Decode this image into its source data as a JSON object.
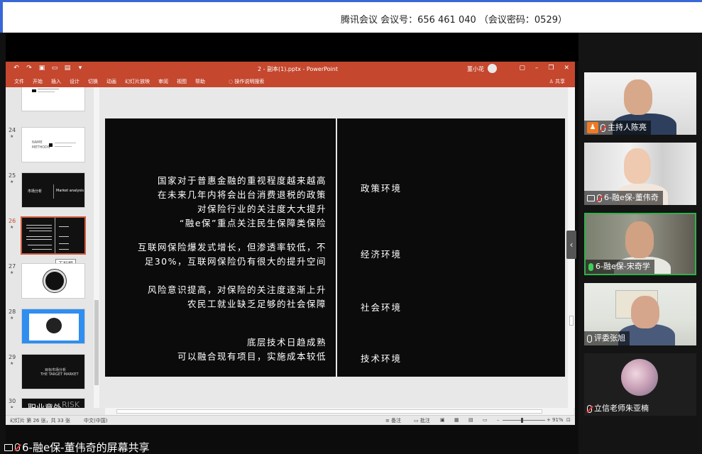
{
  "meeting": {
    "info_text": "腾讯会议  会议号：656 461 040  （会议密码：0529）",
    "share_label": "6-融e保-董伟奇的屏幕共享"
  },
  "ppt": {
    "document_title": "2 - 副本(1).pptx - PowerPoint",
    "user_name": "董小花",
    "ribbon_tabs": [
      "文件",
      "开始",
      "插入",
      "设计",
      "切换",
      "动画",
      "幻灯片放映",
      "审阅",
      "视图",
      "帮助"
    ],
    "tell_me": "操作说明搜索",
    "share": "共享",
    "tooltip": "无标题",
    "thumbnails": [
      {
        "num": "24",
        "text_a": "NAME",
        "text_b": "METHODS"
      },
      {
        "num": "25",
        "text_a": "市场分析",
        "text_b": "Market analysis"
      },
      {
        "num": "26"
      },
      {
        "num": "27"
      },
      {
        "num": "28"
      },
      {
        "num": "29",
        "text_a": "目标市场分析",
        "text_b": "THE TARGET MARKET"
      },
      {
        "num": "30",
        "text_a": "职业意外",
        "text_b": "RISK"
      }
    ],
    "status": {
      "slide_info": "幻灯片 第 26 张，共 33 张",
      "language": "中文(中国)",
      "notes": "备注",
      "comments": "批注",
      "zoom": "91%"
    }
  },
  "slide": {
    "policy_lines": [
      "国家对于普惠金融的重视程度越来越高",
      "在未来几年内将会出台消费退税的政策",
      "对保险行业的关注度大大提升",
      "“融e保”重点关注民生保障类保险"
    ],
    "economy_lines": [
      "互联网保险爆发式增长，但渗透率较低，不",
      "足30%，互联网保险仍有很大的提升空间"
    ],
    "social_lines": [
      "风险意识提高，对保险的关注度逐渐上升",
      "农民工就业缺乏足够的社会保障"
    ],
    "tech_lines": [
      "底层技术日趋成熟",
      "可以融合现有项目，实施成本较低"
    ],
    "labels": [
      "政策环境",
      "经济环境",
      "社会环境",
      "技术环境"
    ]
  },
  "participants": [
    {
      "name": "主持人陈亮",
      "role_icon": "host-icon"
    },
    {
      "name": "6-融e保-董伟奇",
      "role_icon": "screen-share-icon"
    },
    {
      "name": "6-融e保-宋奇学",
      "role_icon": "none"
    },
    {
      "name": "评委张旭",
      "role_icon": "none"
    },
    {
      "name": "立信老师朱亚楠",
      "role_icon": "none"
    }
  ],
  "colors": {
    "ppt_accent": "#c4472e",
    "active_speaker": "#32b04a",
    "top_border": "#3a67d8"
  }
}
